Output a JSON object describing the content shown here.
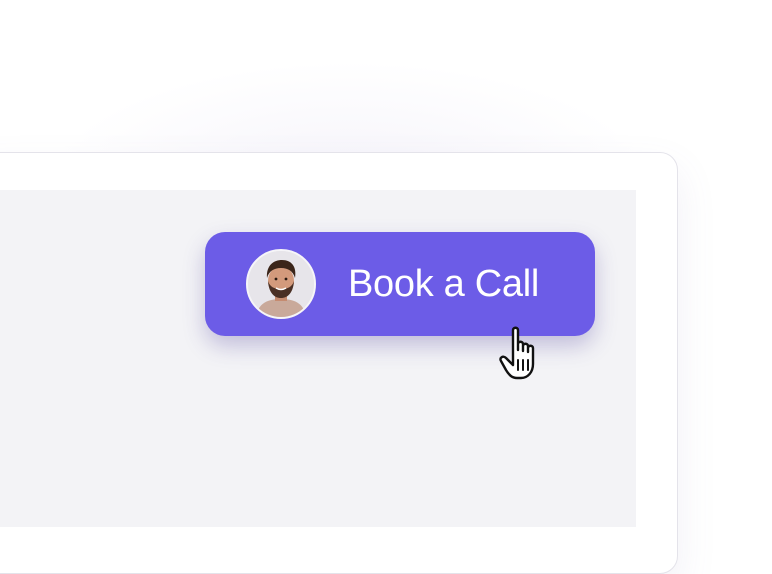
{
  "cta": {
    "label": "Book a Call",
    "accent_color": "#6c5ce7",
    "avatar_icon": "user-photo-avatar"
  },
  "cursor": {
    "icon": "hand-pointer-cursor"
  }
}
